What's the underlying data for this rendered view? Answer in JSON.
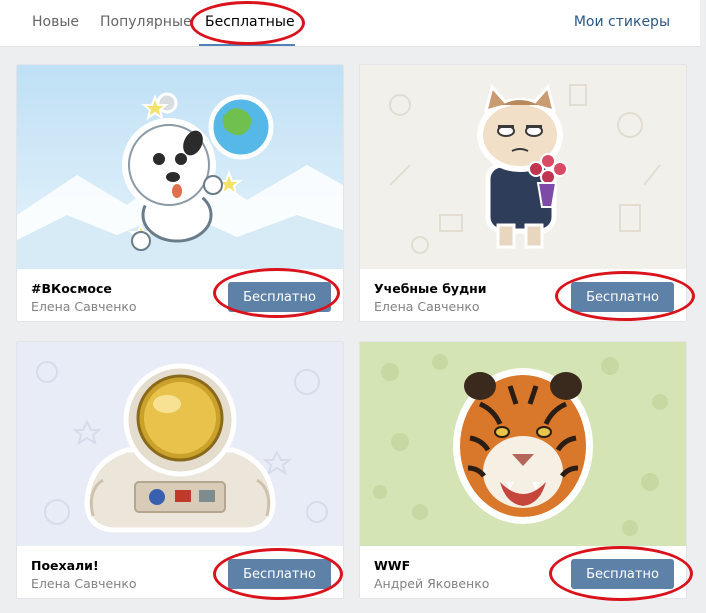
{
  "tabs": {
    "items": [
      {
        "label": "Новые"
      },
      {
        "label": "Популярные"
      },
      {
        "label": "Бесплатные"
      }
    ],
    "active_index": 2,
    "my_stickers": "Мои стикеры"
  },
  "packs": [
    {
      "title": "#ВКосмосе",
      "author": "Елена Савченко",
      "button": "Бесплатно",
      "art": "space-dog-sticker"
    },
    {
      "title": "Учебные будни",
      "author": "Елена Савченко",
      "button": "Бесплатно",
      "art": "school-cat-sticker"
    },
    {
      "title": "Поехали!",
      "author": "Елена Савченко",
      "button": "Бесплатно",
      "art": "astronaut-sticker"
    },
    {
      "title": "WWF",
      "author": "Андрей Яковенко",
      "button": "Бесплатно",
      "art": "tiger-sticker"
    }
  ],
  "colors": {
    "accent": "#5181b8",
    "button": "#5e81a8",
    "highlight_ring": "#d9121b",
    "link": "#2a5885"
  }
}
